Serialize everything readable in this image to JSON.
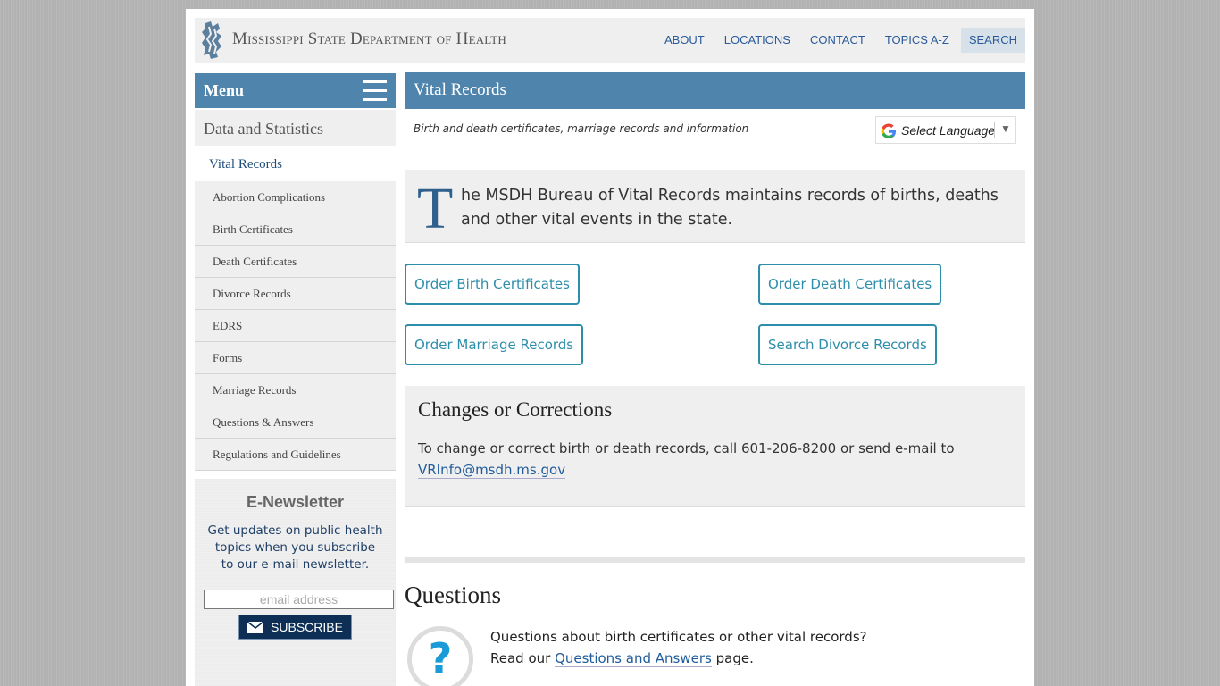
{
  "header": {
    "site_name": "Mississippi State Department of Health",
    "nav": [
      "ABOUT",
      "LOCATIONS",
      "CONTACT",
      "TOPICS A-Z",
      "SEARCH"
    ]
  },
  "sidebar": {
    "menu_label": "Menu",
    "section": "Data and Statistics",
    "active": "Vital Records",
    "items": [
      "Abortion Complications",
      "Birth Certificates",
      "Death Certificates",
      "Divorce Records",
      "EDRS",
      "Forms",
      "Marriage Records",
      "Questions & Answers",
      "Regulations and Guidelines"
    ],
    "newsletter": {
      "title": "E-Newsletter",
      "text": "Get updates on public health topics when you subscribe to our e-mail newsletter.",
      "placeholder": "email address",
      "button": "SUBSCRIBE"
    }
  },
  "main": {
    "title": "Vital Records",
    "subtitle": "Birth and death certificates, marriage records and information",
    "language": "Select Language",
    "intro_cap": "T",
    "intro_rest": "he MSDH Bureau of Vital Records maintains records of births, deaths and other vital events in the state.",
    "buttons": [
      "Order Birth Certificates",
      "Order Death Certificates",
      "Order Marriage Records",
      "Search Divorce Records"
    ],
    "changes": {
      "title": "Changes or Corrections",
      "text": "To change or correct birth or death records, call 601-206-8200 or send e-mail to",
      "email": "VRInfo@msdh.ms.gov"
    },
    "questions": {
      "title": "Questions",
      "line1": "Questions about birth certificates or other vital records?",
      "line2_pre": "Read our",
      "link": "Questions and Answers",
      "line2_post": "page."
    }
  },
  "colors": {
    "brand_blue": "#4f84ad",
    "button_teal": "#2d8eab",
    "link_blue": "#1f5b9a"
  }
}
